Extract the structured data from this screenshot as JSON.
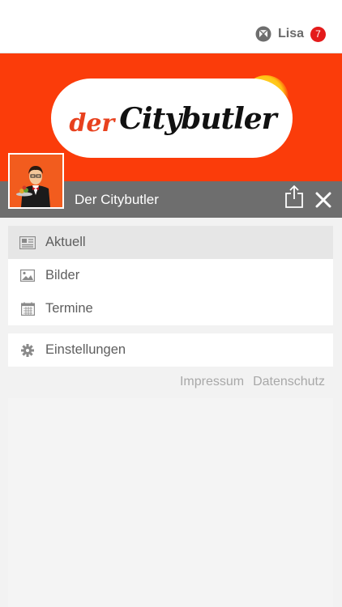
{
  "header": {
    "user_name": "Lisa",
    "notification_count": "7"
  },
  "banner": {
    "logo_text_small": "der",
    "logo_text_large": "Citybutler"
  },
  "title_bar": {
    "title": "Der Citybutler"
  },
  "menu": {
    "items": [
      {
        "label": "Aktuell",
        "icon": "newspaper-icon",
        "active": true
      },
      {
        "label": "Bilder",
        "icon": "image-icon",
        "active": false
      },
      {
        "label": "Termine",
        "icon": "calendar-icon",
        "active": false
      }
    ],
    "settings": {
      "label": "Einstellungen",
      "icon": "gear-icon"
    }
  },
  "footer": {
    "links": [
      "Impressum",
      "Datenschutz"
    ]
  },
  "colors": {
    "banner": "#fb3c0a",
    "title_bar": "#6e6e6e",
    "badge": "#e41b1b",
    "active_item": "#e6e6e6"
  }
}
